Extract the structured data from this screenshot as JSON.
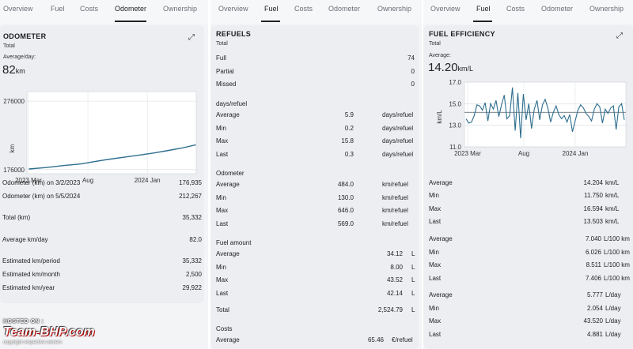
{
  "tabs": [
    "Overview",
    "Fuel",
    "Costs",
    "Odometer",
    "Ownership"
  ],
  "odometer": {
    "title": "ODOMETER",
    "subtitle": "Total",
    "avg_label": "Average/day:",
    "avg_value": "82",
    "avg_unit": "km",
    "rows": [
      {
        "label": "Odometer (km) on 3/2/2023",
        "value": "176,935"
      },
      {
        "label": "Odometer (km) on 5/5/2024",
        "value": "212,267"
      },
      {
        "label": "Total (km)",
        "value": "35,332"
      },
      {
        "label": "Average km/day",
        "value": "82.0"
      },
      {
        "label": "Estimated km/period",
        "value": "35,332"
      },
      {
        "label": "Estimated km/month",
        "value": "2,500"
      },
      {
        "label": "Estimated km/year",
        "value": "29,922"
      }
    ]
  },
  "refuels": {
    "title": "REFUELS",
    "subtitle": "Total",
    "counts": [
      {
        "label": "Full",
        "value": "74"
      },
      {
        "label": "Partial",
        "value": "0"
      },
      {
        "label": "Missed",
        "value": "0"
      }
    ],
    "days_header": "days/refuel",
    "days": [
      {
        "label": "Average",
        "value": "5.9",
        "unit": "days/refuel"
      },
      {
        "label": "Min",
        "value": "0.2",
        "unit": "days/refuel"
      },
      {
        "label": "Max",
        "value": "15.8",
        "unit": "days/refuel"
      },
      {
        "label": "Last",
        "value": "0.3",
        "unit": "days/refuel"
      }
    ],
    "odo_header": "Odometer",
    "odo": [
      {
        "label": "Average",
        "value": "484.0",
        "unit": "km/refuel"
      },
      {
        "label": "Min",
        "value": "130.0",
        "unit": "km/refuel"
      },
      {
        "label": "Max",
        "value": "646.0",
        "unit": "km/refuel"
      },
      {
        "label": "Last",
        "value": "569.0",
        "unit": "km/refuel"
      }
    ],
    "fuel_header": "Fuel amount",
    "fuel": [
      {
        "label": "Average",
        "value": "34.12",
        "unit": "L"
      },
      {
        "label": "Min",
        "value": "8.00",
        "unit": "L"
      },
      {
        "label": "Max",
        "value": "43.52",
        "unit": "L"
      },
      {
        "label": "Last",
        "value": "42.14",
        "unit": "L"
      }
    ],
    "total_label": "Total",
    "total_value": "2,524.79",
    "total_unit": "L",
    "costs_header": "Costs",
    "costs": [
      {
        "label": "Average",
        "value": "65.46",
        "unit": "€/refuel"
      }
    ]
  },
  "efficiency": {
    "title": "FUEL EFFICIENCY",
    "subtitle": "Total",
    "avg_label": "Average:",
    "avg_value": "14.20",
    "avg_unit": "km/L",
    "kml": [
      {
        "label": "Average",
        "value": "14.204",
        "unit": "km/L"
      },
      {
        "label": "Min",
        "value": "11.750",
        "unit": "km/L"
      },
      {
        "label": "Max",
        "value": "16.594",
        "unit": "km/L"
      },
      {
        "label": "Last",
        "value": "13.503",
        "unit": "km/L"
      }
    ],
    "l100": [
      {
        "label": "Average",
        "value": "7.040",
        "unit": "L/100 km"
      },
      {
        "label": "Min",
        "value": "6.026",
        "unit": "L/100 km"
      },
      {
        "label": "Max",
        "value": "8.511",
        "unit": "L/100 km"
      },
      {
        "label": "Last",
        "value": "7.406",
        "unit": "L/100 km"
      }
    ],
    "lday": [
      {
        "label": "Average",
        "value": "5.777",
        "unit": "L/day"
      },
      {
        "label": "Min",
        "value": "2.054",
        "unit": "L/day"
      },
      {
        "label": "Max",
        "value": "43.520",
        "unit": "L/day"
      },
      {
        "label": "Last",
        "value": "4.881",
        "unit": "L/day"
      }
    ]
  },
  "watermark": {
    "hosted": "HOSTED ON :",
    "brand": "Team-BHP.com",
    "copyright": "copyright respective owners"
  },
  "chart_data": [
    {
      "type": "line",
      "ylabel": "km",
      "ylim": [
        170000,
        290000
      ],
      "yticks": [
        "276000",
        "176000"
      ],
      "xticks": [
        "2023 Mar",
        "Aug",
        "2024 Jan"
      ],
      "series": [
        {
          "x": [
            "2023-03-02",
            "2023-04-15",
            "2023-06-01",
            "2023-07-15",
            "2023-08-10",
            "2023-09-20",
            "2023-11-01",
            "2023-12-15",
            "2024-01-20",
            "2024-02-25",
            "2024-03-30",
            "2024-05-05"
          ],
          "values": [
            176935,
            179000,
            182000,
            184300,
            187000,
            190800,
            194000,
            197500,
            200500,
            204000,
            207500,
            212267
          ]
        }
      ],
      "color": "#2e6e8e",
      "grid": true
    },
    {
      "type": "line",
      "ylabel": "km/L",
      "ylim": [
        11.0,
        17.0
      ],
      "yticks": [
        "17.0",
        "15.0",
        "13.0",
        "11.0"
      ],
      "xticks": [
        "2023 Mar",
        "Aug",
        "2024 Jan"
      ],
      "average_line": 14.2,
      "series": [
        {
          "values": [
            13.6,
            13.2,
            13.3,
            13.9,
            14.9,
            14.8,
            14.4,
            15.1,
            13.4,
            15.0,
            14.5,
            15.3,
            13.8,
            14.9,
            15.8,
            13.6,
            13.9,
            16.5,
            12.5,
            16.0,
            11.8,
            15.9,
            13.5,
            15.0,
            12.7,
            14.5,
            15.3,
            13.5,
            14.9,
            15.4,
            14.6,
            13.3,
            14.2,
            14.8,
            14.0,
            13.6,
            13.9,
            13.3,
            14.0,
            12.4,
            13.4,
            14.4,
            14.9,
            14.6,
            14.1,
            13.8,
            13.4,
            14.5,
            15.0,
            14.7,
            13.2,
            14.5,
            14.1,
            14.6,
            14.8,
            12.6,
            14.7,
            15.0,
            13.5
          ]
        }
      ],
      "color": "#2e6e8e",
      "grid": true
    }
  ]
}
